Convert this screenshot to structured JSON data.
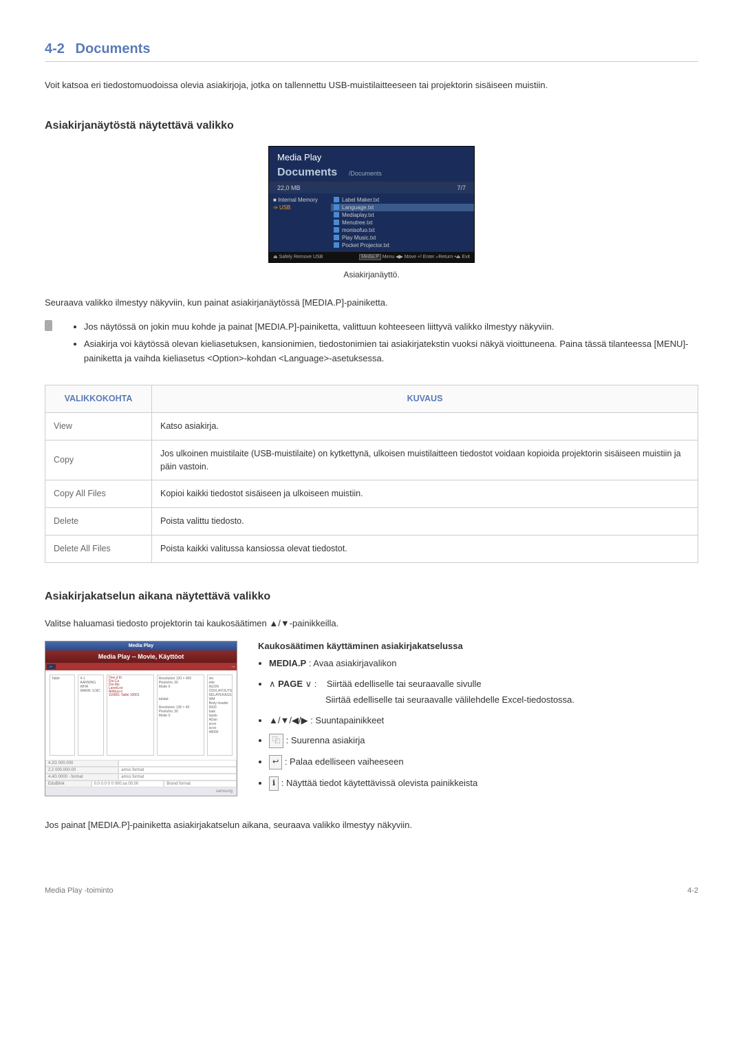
{
  "section": {
    "number": "4-2",
    "title": "Documents"
  },
  "intro": "Voit katsoa eri tiedostomuodoissa olevia asiakirjoja, jotka on tallennettu USB-muistilaitteeseen tai projektorin sisäiseen muistiin.",
  "subheading1": "Asiakirjanäytöstä näytettävä valikko",
  "mediaplay": {
    "title": "Media Play",
    "docs": "Documents",
    "path": "/Documents",
    "storage_size": "22,0 MB",
    "storage_count": "7/7",
    "sidebar": {
      "internal": "Internal Memory",
      "usb": "USB"
    },
    "files": [
      "Label Maker.txt",
      "Language.txt",
      "Mediaplay.txt",
      "Menutree.txt",
      "monisofuo.txt",
      "Play Music.txt",
      "Pocket Projector.txt"
    ],
    "footer_left": "Safely Remove USB",
    "footer_right": "Media.P Menu ◀▶ Move ⏎ Enter ⤶ Return ⏏ Exit"
  },
  "caption1": "Asiakirjanäyttö.",
  "para1": "Seuraava valikko ilmestyy näkyviin, kun painat asiakirjanäytössä [MEDIA.P]-painiketta.",
  "notes": [
    "Jos näytössä on jokin muu kohde ja painat [MEDIA.P]-painiketta, valittuun kohteeseen liittyvä valikko ilmestyy näkyviin.",
    "Asiakirja voi käytössä olevan kieliasetuksen, kansionimien, tiedostonimien tai asiakirjatekstin vuoksi näkyä vioittuneena. Paina tässä tilanteessa [MENU]-painiketta ja vaihda kieliasetus <Option>-kohdan <Language>-asetuksessa."
  ],
  "table": {
    "headers": [
      "VALIKKOKOHTA",
      "KUVAUS"
    ],
    "rows": [
      [
        "View",
        "Katso asiakirja."
      ],
      [
        "Copy",
        "Jos ulkoinen muistilaite (USB-muistilaite) on kytkettynä, ulkoisen muistilaitteen tiedostot voidaan kopioida projektorin sisäiseen muistiin ja päin vastoin."
      ],
      [
        "Copy All Files",
        "Kopioi kaikki tiedostot sisäiseen ja ulkoiseen muistiin."
      ],
      [
        "Delete",
        "Poista valittu tiedosto."
      ],
      [
        "Delete All Files",
        "Poista kaikki valitussa kansiossa olevat tiedostot."
      ]
    ]
  },
  "subheading2": "Asiakirjakatselun aikana näytettävä valikko",
  "para2": "Valitse haluamasi tiedosto projektorin tai kaukosäätimen ▲/▼-painikkeilla.",
  "docview": {
    "title": "Media Play",
    "header": "Media Play -- Movie, Käyttöot",
    "sub_left": "←",
    "sub_right": "→",
    "footer_rows": [
      [
        "4.2G 000.000",
        ""
      ],
      [
        "2.2 000.000.00",
        "amss format"
      ],
      [
        "4.4G 0000 - format",
        "amss format"
      ],
      [
        "EduBlink",
        "0.0 0.0 0 0 000.sa 00.00",
        "Brand format"
      ]
    ],
    "bottom_left": "",
    "bottom_right": "samsung"
  },
  "remote": {
    "heading": "Kaukosäätimen käyttäminen asiakirjakatselussa",
    "items": {
      "mediap_label": "MEDIA.P",
      "mediap_desc": " : Avaa asiakirjavalikon",
      "page_pre": "∧ ",
      "page_label": "PAGE",
      "page_post": " ∨  :",
      "page_desc1": "Siirtää edelliselle tai seuraavalle sivulle",
      "page_desc2": "Siirtää edelliselle tai seuraavalle välilehdelle Excel-tiedostossa.",
      "arrows": "▲/▼/◀/▶",
      "arrows_desc": " : Suuntapainikkeet",
      "zoom_icon": "⿻",
      "zoom_desc": " : Suurenna asiakirja",
      "back_desc": " : Palaa edelliseen vaiheeseen",
      "info_desc": " : Näyttää tiedot käytettävissä olevista painikkeista"
    }
  },
  "para3": "Jos painat [MEDIA.P]-painiketta asiakirjakatselun aikana, seuraava valikko ilmestyy näkyviin.",
  "footer": {
    "left": "Media Play -toiminto",
    "right": "4-2"
  }
}
